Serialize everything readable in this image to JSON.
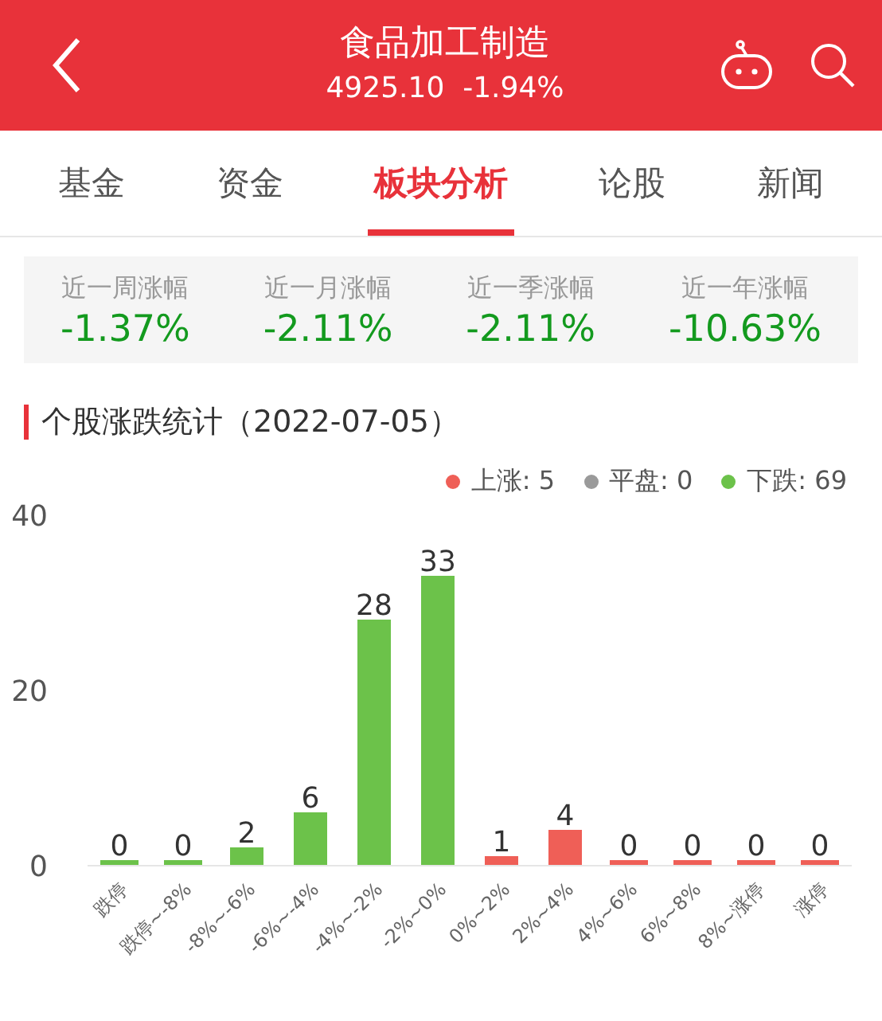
{
  "header": {
    "title": "食品加工制造",
    "price": "4925.10",
    "change": "-1.94%"
  },
  "tabs": [
    {
      "label": "基金",
      "selected": false
    },
    {
      "label": "资金",
      "selected": false
    },
    {
      "label": "板块分析",
      "selected": true
    },
    {
      "label": "论股",
      "selected": false
    },
    {
      "label": "新闻",
      "selected": false
    }
  ],
  "stats": [
    {
      "label": "近一周涨幅",
      "value": "-1.37%"
    },
    {
      "label": "近一月涨幅",
      "value": "-2.11%"
    },
    {
      "label": "近一季涨幅",
      "value": "-2.11%"
    },
    {
      "label": "近一年涨幅",
      "value": "-10.63%"
    }
  ],
  "section_title": "个股涨跌统计（2022-07-05）",
  "legend": [
    {
      "label": "上涨: 5",
      "color": "#ef5f57"
    },
    {
      "label": "平盘: 0",
      "color": "#9a9a9a"
    },
    {
      "label": "下跌: 69",
      "color": "#6cc24a"
    }
  ],
  "chart_data": {
    "type": "bar",
    "categories": [
      "跌停",
      "跌停~-8%",
      "-8%~-6%",
      "-6%~-4%",
      "-4%~-2%",
      "-2%~0%",
      "0%~2%",
      "2%~4%",
      "4%~6%",
      "6%~8%",
      "8%~涨停",
      "涨停"
    ],
    "series": [
      {
        "color": "#6cc24a",
        "values": [
          0,
          0,
          2,
          6,
          28,
          33,
          null,
          null,
          null,
          null,
          null,
          null
        ]
      },
      {
        "color": "#ef5f57",
        "values": [
          null,
          null,
          null,
          null,
          null,
          null,
          1,
          4,
          0,
          0,
          0,
          0
        ]
      }
    ],
    "ylim": [
      0,
      40
    ],
    "yticks": [
      0,
      20,
      40
    ],
    "data_labels": true
  }
}
